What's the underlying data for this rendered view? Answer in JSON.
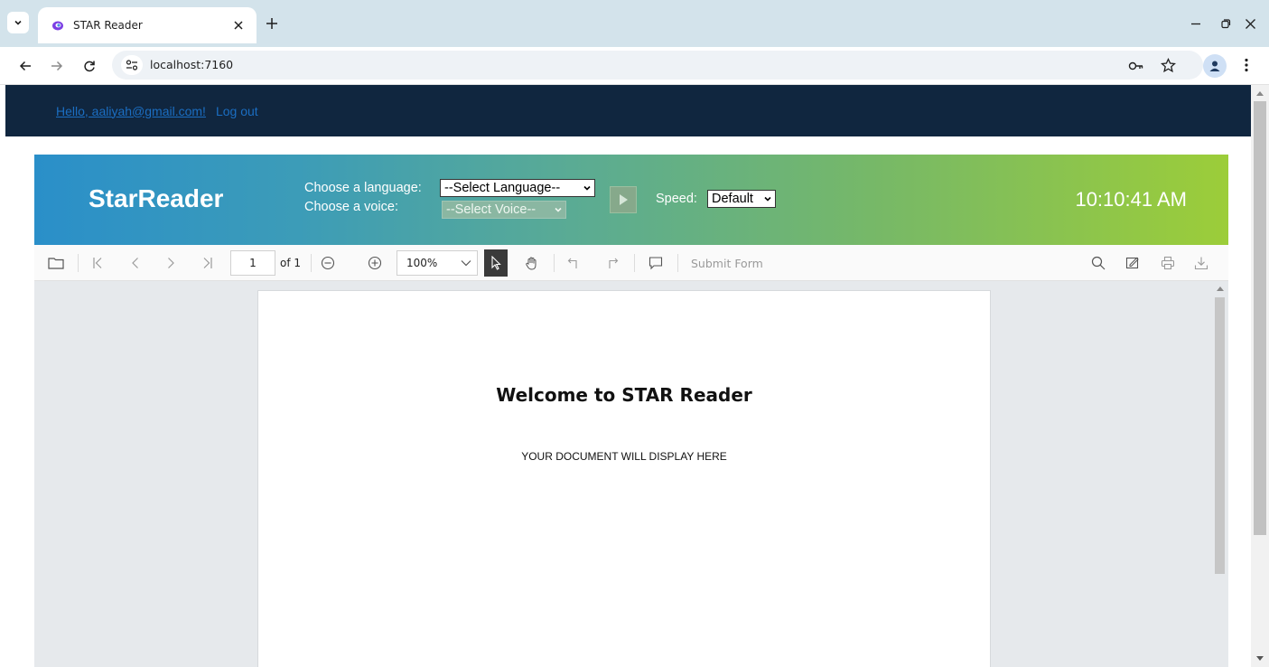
{
  "browser": {
    "tab_title": "STAR Reader",
    "url": "localhost:7160",
    "icons": [
      "tab-list-icon",
      "star-reader-favicon",
      "close-icon",
      "plus-icon",
      "minimize-icon",
      "restore-icon",
      "close-window-icon",
      "back-icon",
      "forward-icon",
      "reload-icon",
      "site-info-icon",
      "password-key-icon",
      "bookmark-star-icon",
      "profile-icon",
      "more-menu-icon"
    ]
  },
  "topnav": {
    "greeting": "Hello, aaliyah@gmail.com!",
    "logout": "Log out"
  },
  "header": {
    "brand": "StarReader",
    "language_label": "Choose a language:",
    "language_select": "--Select Language--",
    "voice_label": "Choose a voice:",
    "voice_select": "--Select Voice--",
    "speed_label": "Speed:",
    "speed_select": "Default",
    "clock": "10:10:41 AM",
    "colors": {
      "gradient_start": "#2a8fc9",
      "gradient_end": "#9ccd39",
      "nav_bg": "#10263f"
    }
  },
  "pdf_toolbar": {
    "page_number": "1",
    "page_count": "of 1",
    "zoom": "100%",
    "submit_form": "Submit Form",
    "icons": [
      "open-file-icon",
      "first-page-icon",
      "previous-page-icon",
      "next-page-icon",
      "last-page-icon",
      "zoom-out-icon",
      "zoom-in-icon",
      "text-select-icon",
      "pan-hand-icon",
      "undo-icon",
      "redo-icon",
      "comment-icon",
      "search-icon",
      "annotation-icon",
      "print-icon",
      "download-icon"
    ]
  },
  "document": {
    "title": "Welcome to STAR Reader",
    "subtitle": "YOUR DOCUMENT WILL DISPLAY HERE"
  }
}
